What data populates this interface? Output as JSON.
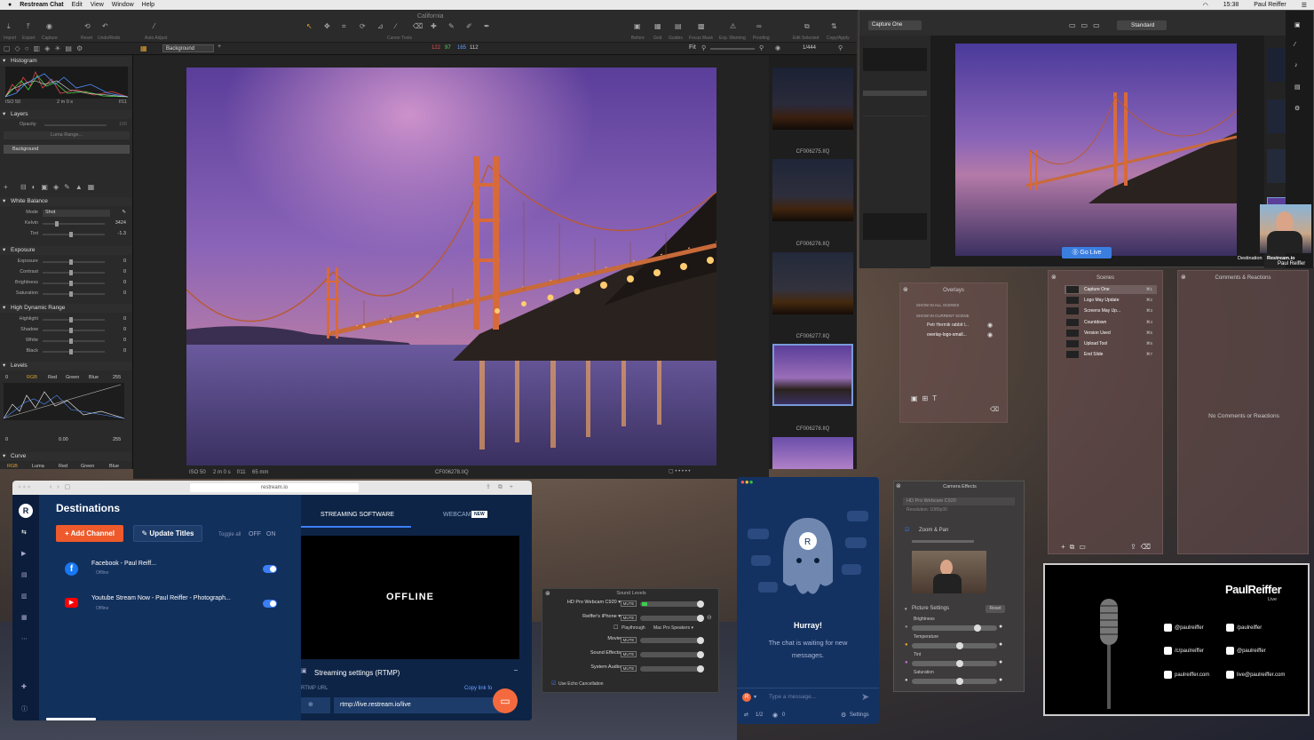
{
  "menubar": {
    "app": "Restream Chat",
    "items": [
      "Edit",
      "View",
      "Window",
      "Help"
    ],
    "time": "15:38",
    "user": "Paul Reiffer"
  },
  "captureone": {
    "title": "California",
    "toolbar_left": [
      "Import",
      "Export",
      "Capture"
    ],
    "toolbar_undo": [
      "Reset",
      "Undo/Redo"
    ],
    "auto_adjust": "Auto Adjust",
    "cursor_tools": "Cursor Tools",
    "toolbar_right": [
      "Before",
      "Grid",
      "Guides",
      "Focus Mask",
      "Exp. Warning",
      "Proofing"
    ],
    "edit_selected": "Edit Selected",
    "copy_apply": "Copy/Apply",
    "layer_select": "Background",
    "rgb": [
      "122",
      "97",
      "165",
      "112"
    ],
    "fit": "Fit",
    "count": "1/444",
    "histogram": {
      "title": "Histogram",
      "iso": "ISO 50",
      "time": "2 m 0 s",
      "fstop": "f/11"
    },
    "layers": {
      "title": "Layers",
      "opacity": "Opacity",
      "opacity_val": "100",
      "luma": "Luma Range...",
      "bg": "Background"
    },
    "wb": {
      "title": "White Balance",
      "mode_lbl": "Mode",
      "mode": "Shot",
      "kelvin_lbl": "Kelvin",
      "kelvin": "3424",
      "tint_lbl": "Tint",
      "tint": "-1.3"
    },
    "exposure": {
      "title": "Exposure",
      "rows": [
        {
          "l": "Exposure",
          "v": "0"
        },
        {
          "l": "Contrast",
          "v": "0"
        },
        {
          "l": "Brightness",
          "v": "0"
        },
        {
          "l": "Saturation",
          "v": "0"
        }
      ]
    },
    "hdr": {
      "title": "High Dynamic Range",
      "rows": [
        {
          "l": "Highlight",
          "v": "0"
        },
        {
          "l": "Shadow",
          "v": "0"
        },
        {
          "l": "White",
          "v": "0"
        },
        {
          "l": "Black",
          "v": "0"
        }
      ]
    },
    "levels": {
      "title": "Levels",
      "tabs": [
        "RGB",
        "Red",
        "Green",
        "Blue"
      ],
      "lo": "0",
      "hi": "255",
      "mid": "0.00",
      "lo2": "0",
      "hi2": "255"
    },
    "curve": {
      "title": "Curve",
      "tabs": [
        "RGB",
        "Luma",
        "Red",
        "Green",
        "Blue"
      ]
    },
    "status": {
      "iso": "ISO 50",
      "time": "2 m 0 s",
      "fstop": "f/11",
      "focal": "65 mm",
      "file": "CF006278.IIQ"
    },
    "thumbs": [
      "CF006275.IIQ",
      "CF006276.IIQ",
      "CF006277.IIQ",
      "CF006278.IIQ"
    ]
  },
  "mini": {
    "capture": "Capture One",
    "standard": "Standard",
    "go_live": "Go Live",
    "destination": "Destination",
    "restream": "Restream.io",
    "name": "Paul Reiffer"
  },
  "overlays": {
    "title": "Overlays",
    "all": "SHOW IN ALL SCENES",
    "current": "SHOW IN CURRENT SCENE",
    "items": [
      "Petr Hermik rabbit l...",
      "overlay-logo-small..."
    ]
  },
  "scenes": {
    "title": "Scenes",
    "items": [
      {
        "n": "Capture One",
        "k": "⌘1"
      },
      {
        "n": "Logo May Update",
        "k": "⌘2"
      },
      {
        "n": "Screens May Up...",
        "k": "⌘3"
      },
      {
        "n": "Countdown",
        "k": "⌘4"
      },
      {
        "n": "Version Used",
        "k": "⌘5"
      },
      {
        "n": "Upload Tool",
        "k": "⌘6"
      },
      {
        "n": "End Slide",
        "k": "⌘7"
      }
    ]
  },
  "comments": {
    "title": "Comments & Reactions",
    "empty": "No Comments or Reactions"
  },
  "restream": {
    "url": "restream.io",
    "title": "Destinations",
    "add": "+ Add Channel",
    "update": "✎ Update Titles",
    "toggle_all": "Toggle all",
    "off": "OFF",
    "on": "ON",
    "channels": [
      {
        "name": "Facebook - Paul Reiff...",
        "status": "Offline"
      },
      {
        "name": "Youtube Stream Now - Paul Reiffer - Photograph...",
        "status": "Offline"
      }
    ],
    "tab1": "STREAMING SOFTWARE",
    "tab2": "WEBCAM",
    "new": "NEW",
    "offline": "OFFLINE",
    "settings": "Streaming settings (RTMP)",
    "rtmp_lbl": "RTMP URL",
    "copy": "Copy link fo",
    "rtmp": "rtmp://live.restream.io/live"
  },
  "chat": {
    "hurray": "Hurray!",
    "waiting": "The chat is waiting for new messages.",
    "placeholder": "Type a message...",
    "count": "1/2",
    "viewers": "0",
    "settings": "Settings"
  },
  "sound": {
    "title": "Sound Levels",
    "rows": [
      {
        "n": "HD Pro Webcam C920 ▾",
        "m": "MUTE"
      },
      {
        "n": "Reiffer's iPhone ▾",
        "m": "MUTE"
      },
      {
        "n": "Movie",
        "m": "MUTE"
      },
      {
        "n": "Sound Effects",
        "m": "MUTE"
      },
      {
        "n": "System Audio",
        "m": "MUTE"
      }
    ],
    "playthrough": "Playthrough",
    "speakers": "Mac Pro Speakers ▾",
    "muted": "MUTED",
    "echo": "Use Echo Cancellation"
  },
  "camera": {
    "title": "Camera Effects",
    "device": "HD Pro Webcam C920",
    "res": "Resolution: 1080p30",
    "zoom": "Zoom & Pan",
    "picture": "Picture Settings",
    "reset": "Reset",
    "settings": [
      "Brightness",
      "Temperature",
      "Tint",
      "Saturation"
    ]
  },
  "overlay_card": {
    "name": "PaulReiffer",
    "live": "Live",
    "socials": [
      {
        "t": "@paulreiffer"
      },
      {
        "t": "/paulreiffer"
      },
      {
        "t": "/c/paulreiffer"
      },
      {
        "t": "@paulreiffer"
      },
      {
        "t": "paulreiffer.com"
      },
      {
        "t": "live@paulreiffer.com"
      }
    ]
  }
}
